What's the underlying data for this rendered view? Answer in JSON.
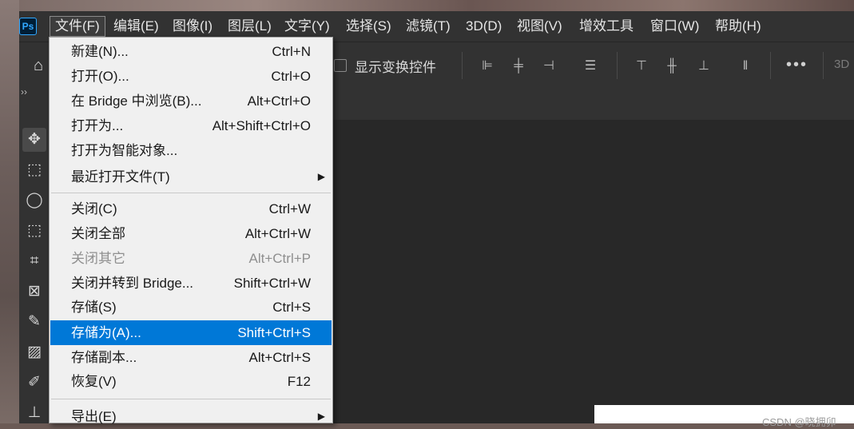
{
  "app": {
    "logo": "Ps"
  },
  "menubar": {
    "items": [
      "文件(F)",
      "编辑(E)",
      "图像(I)",
      "图层(L)",
      "文字(Y)",
      "选择(S)",
      "滤镜(T)",
      "3D(D)",
      "视图(V)",
      "增效工具",
      "窗口(W)",
      "帮助(H)"
    ]
  },
  "options": {
    "show_transform_label": "显示变换控件",
    "more_label": "•••",
    "label_3d": "3D"
  },
  "file_menu": {
    "items": [
      {
        "label": "新建(N)...",
        "shortcut": "Ctrl+N"
      },
      {
        "label": "打开(O)...",
        "shortcut": "Ctrl+O"
      },
      {
        "label": "在 Bridge 中浏览(B)...",
        "shortcut": "Alt+Ctrl+O"
      },
      {
        "label": "打开为...",
        "shortcut": "Alt+Shift+Ctrl+O"
      },
      {
        "label": "打开为智能对象...",
        "shortcut": ""
      },
      {
        "label": "最近打开文件(T)",
        "shortcut": ""
      },
      {
        "label": "关闭(C)",
        "shortcut": "Ctrl+W"
      },
      {
        "label": "关闭全部",
        "shortcut": "Alt+Ctrl+W"
      },
      {
        "label": "关闭其它",
        "shortcut": "Alt+Ctrl+P"
      },
      {
        "label": "关闭并转到 Bridge...",
        "shortcut": "Shift+Ctrl+W"
      },
      {
        "label": "存储(S)",
        "shortcut": "Ctrl+S"
      },
      {
        "label": "存储为(A)...",
        "shortcut": "Shift+Ctrl+S"
      },
      {
        "label": "存储副本...",
        "shortcut": "Alt+Ctrl+S"
      },
      {
        "label": "恢复(V)",
        "shortcut": "F12"
      },
      {
        "label": "导出(E)",
        "shortcut": ""
      }
    ]
  },
  "watermark": "CSDN @晓拥卯",
  "colors": {
    "highlight": "#0078d7",
    "menu_bg": "#f0f0f0",
    "app_bg": "#323232"
  },
  "toolbar": {
    "collapse": "››"
  }
}
